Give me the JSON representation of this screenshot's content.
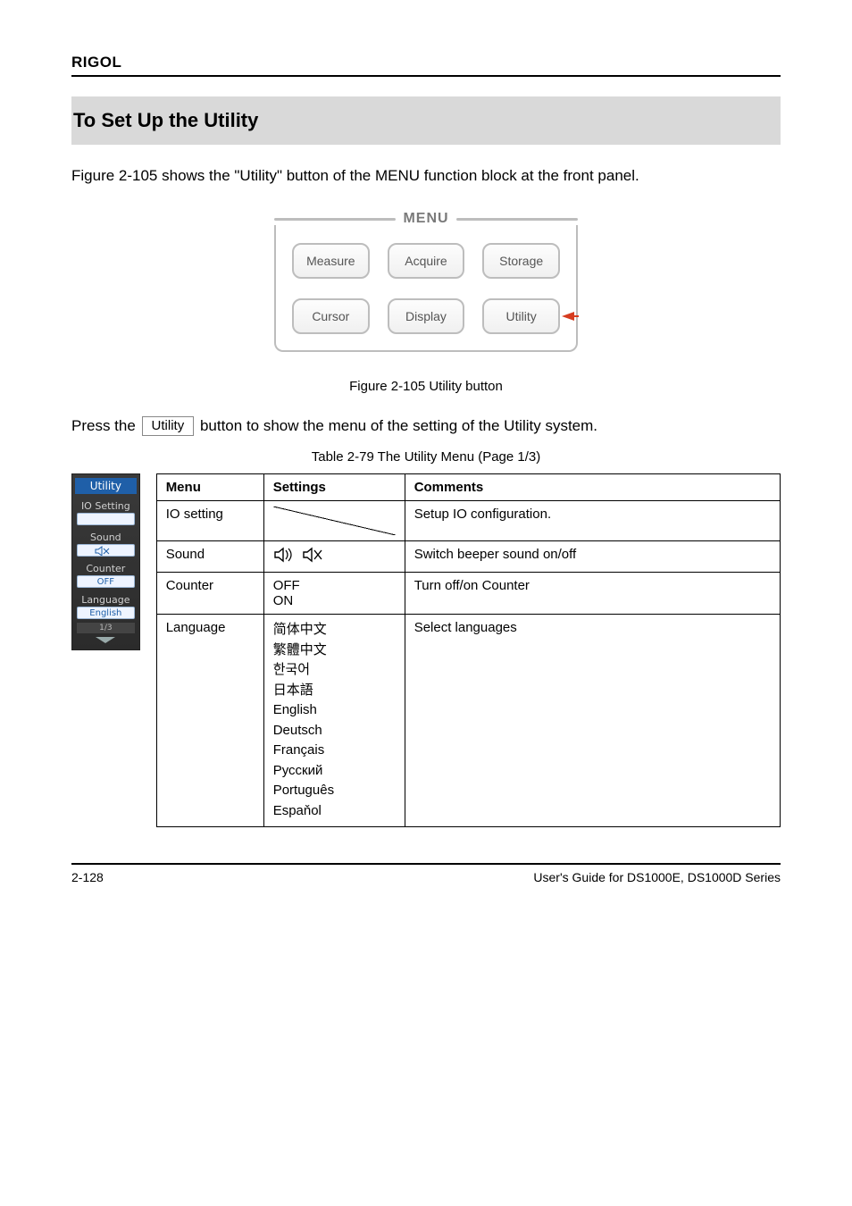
{
  "header": {
    "brand": "RIGOL"
  },
  "section_title": "To Set Up the Utility",
  "intro": "Figure 2-105 shows the \"Utility\" button of the MENU function block at the front panel.",
  "menu": {
    "title": "MENU",
    "buttons": [
      "Measure",
      "Acquire",
      "Storage",
      "Cursor",
      "Display",
      "Utility"
    ]
  },
  "fig_caption": "Figure 2-105 Utility button",
  "press_line_parts": {
    "prefix": "Press the ",
    "button": "Utility",
    "suffix": " button to show the menu of the setting of the Utility system."
  },
  "table_caption": "Table 2-79 The Utility Menu (Page 1/3)",
  "osd": {
    "head": "Utility",
    "items": [
      {
        "label": "IO Setting",
        "value": ""
      },
      {
        "label": "Sound",
        "value_icon": "speaker-mute"
      },
      {
        "label": "Counter",
        "value": "OFF"
      },
      {
        "label": "Language",
        "value": "English"
      }
    ],
    "page": "1/3"
  },
  "table": {
    "headers": [
      "Menu",
      "Settings",
      "Comments"
    ],
    "rows": [
      {
        "menu": "IO setting",
        "settings_kind": "slash",
        "comments": "Setup IO configuration."
      },
      {
        "menu": "Sound",
        "settings_kind": "sound",
        "comments": "Switch beeper sound on/off"
      },
      {
        "menu": "Counter",
        "settings_kind": "counter",
        "settings_lines": [
          "OFF",
          "ON"
        ],
        "comments": "Turn off/on Counter"
      },
      {
        "menu": "Language",
        "settings_kind": "lang",
        "settings_lines": [
          "简体中文",
          "繁體中文",
          "한국어",
          "日本語",
          "English",
          "Deutsch",
          "Français",
          "Русский",
          "Português",
          "Espaňol"
        ],
        "comments": "Select languages"
      }
    ]
  },
  "footer": {
    "page": "2-128",
    "doc": "User's Guide for DS1000E, DS1000D Series"
  }
}
